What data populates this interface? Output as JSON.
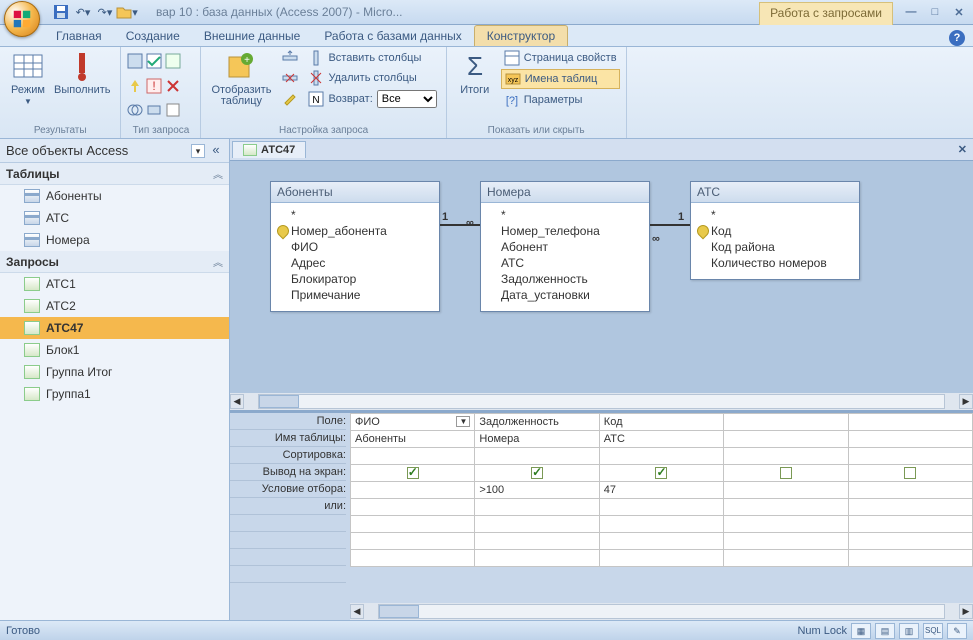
{
  "title": "вар 10 : база данных (Access 2007) - Micro...",
  "context_tab": "Работа с запросами",
  "tabs": [
    "Главная",
    "Создание",
    "Внешние данные",
    "Работа с базами данных",
    "Конструктор"
  ],
  "active_tab": 4,
  "ribbon": {
    "grp_results": "Результаты",
    "mode": "Режим",
    "run": "Выполнить",
    "grp_qtype": "Тип запроса",
    "grp_setup": "Настройка запроса",
    "show_table": "Отобразить\nтаблицу",
    "insert_cols": "Вставить столбцы",
    "delete_cols": "Удалить столбцы",
    "return": "Возврат:",
    "return_val": "Все",
    "grp_totals": "Итоги",
    "totals": "Итоги",
    "grp_show": "Показать или скрыть",
    "prop_page": "Страница свойств",
    "table_names": "Имена таблиц",
    "params": "Параметры"
  },
  "nav": {
    "header": "Все объекты Access",
    "grp_tables": "Таблицы",
    "grp_queries": "Запросы",
    "tables": [
      "Абоненты",
      "АТС",
      "Номера"
    ],
    "queries": [
      "АТС1",
      "АТС2",
      "АТС47",
      "Блок1",
      "Группа Итог",
      "Группа1"
    ],
    "selected": "АТС47"
  },
  "doc_tab": "АТС47",
  "tables": {
    "t1": {
      "title": "Абоненты",
      "fields": [
        "*",
        "Номер_абонента",
        "ФИО",
        "Адрес",
        "Блокиратор",
        "Примечание"
      ],
      "key": 1
    },
    "t2": {
      "title": "Номера",
      "fields": [
        "*",
        "Номер_телефона",
        "Абонент",
        "АТС",
        "Задолженность",
        "Дата_установки"
      ]
    },
    "t3": {
      "title": "АТС",
      "fields": [
        "*",
        "Код",
        "Код района",
        "Количество номеров"
      ],
      "key": 1
    }
  },
  "grid": {
    "labels": [
      "Поле:",
      "Имя таблицы:",
      "Сортировка:",
      "Вывод на экран:",
      "Условие отбора:",
      "или:"
    ],
    "cols": [
      {
        "field": "ФИО",
        "table": "Абоненты",
        "show": true,
        "crit": ""
      },
      {
        "field": "Задолженность",
        "table": "Номера",
        "show": true,
        "crit": ">100"
      },
      {
        "field": "Код",
        "table": "АТС",
        "show": true,
        "crit": "47"
      },
      {
        "field": "",
        "table": "",
        "show": false,
        "crit": ""
      },
      {
        "field": "",
        "table": "",
        "show": false,
        "crit": ""
      }
    ]
  },
  "status": {
    "ready": "Готово",
    "numlock": "Num Lock"
  }
}
